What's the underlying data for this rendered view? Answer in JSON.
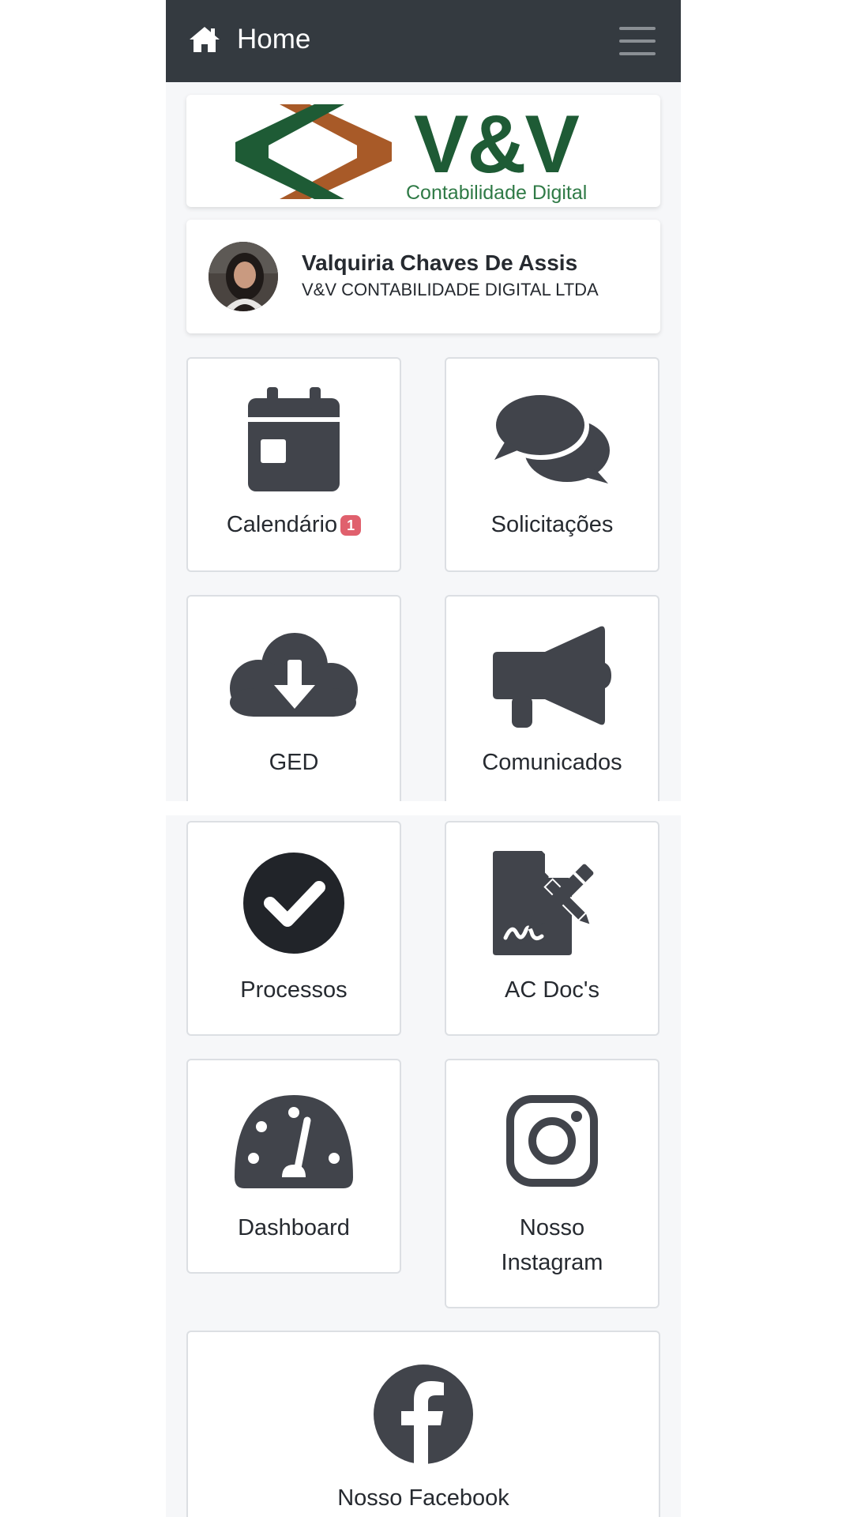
{
  "navbar": {
    "title": "Home",
    "home_icon": "home-icon",
    "menu_icon": "hamburger-menu-icon"
  },
  "logo": {
    "main_text": "V&V",
    "sub_text": "Contabilidade Digital",
    "colors": {
      "green": "#1e5b35",
      "brown": "#a85a28"
    }
  },
  "user": {
    "name": "Valquiria Chaves De Assis",
    "company": "V&V CONTABILIDADE DIGITAL LTDA"
  },
  "tiles": [
    {
      "label": "Calendário",
      "icon": "calendar-icon",
      "badge": "1"
    },
    {
      "label": "Solicitações",
      "icon": "chat-bubbles-icon"
    },
    {
      "label": "GED",
      "icon": "cloud-download-icon"
    },
    {
      "label": "Comunicados",
      "icon": "megaphone-icon"
    },
    {
      "label": "Processos",
      "icon": "check-circle-icon"
    },
    {
      "label": "AC Doc's",
      "icon": "signature-document-icon"
    },
    {
      "label": "Dashboard",
      "icon": "gauge-icon"
    },
    {
      "label": "Nosso Instagram",
      "label_line1": "Nosso",
      "label_line2": "Instagram",
      "icon": "instagram-icon"
    },
    {
      "label": "Nosso Facebook",
      "icon": "facebook-icon"
    }
  ],
  "colors": {
    "navbar_bg": "#343a40",
    "icon": "#41444b",
    "badge": "#e0606d",
    "page_bg": "#f6f7f9"
  }
}
